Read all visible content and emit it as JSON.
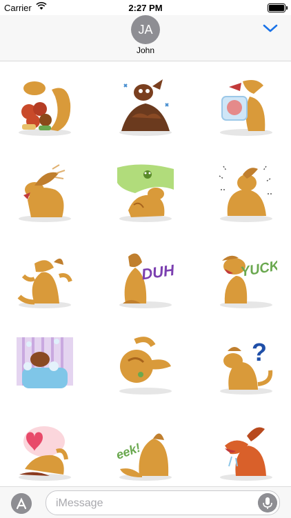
{
  "status_bar": {
    "carrier": "Carrier",
    "time": "2:27 PM"
  },
  "header": {
    "avatar_initials": "JA",
    "contact_name": "John"
  },
  "stickers": [
    {
      "name": "sticker-dog-burgers",
      "caption": ""
    },
    {
      "name": "sticker-dog-mud-pile",
      "caption": ""
    },
    {
      "name": "sticker-dog-ice-cube",
      "caption": ""
    },
    {
      "name": "sticker-dog-scratching",
      "caption": ""
    },
    {
      "name": "sticker-dog-stink",
      "caption": ""
    },
    {
      "name": "sticker-dog-shaking",
      "caption": ""
    },
    {
      "name": "sticker-dog-pointing",
      "caption": ""
    },
    {
      "name": "sticker-dog-duh",
      "caption": "DUH"
    },
    {
      "name": "sticker-dog-yuck",
      "caption": "YUCK"
    },
    {
      "name": "sticker-dog-bath",
      "caption": ""
    },
    {
      "name": "sticker-dog-rolling",
      "caption": ""
    },
    {
      "name": "sticker-dog-question",
      "caption": "?"
    },
    {
      "name": "sticker-dog-love",
      "caption": ""
    },
    {
      "name": "sticker-dog-eek",
      "caption": "eek!"
    },
    {
      "name": "sticker-dog-howl",
      "caption": ""
    }
  ],
  "message_bar": {
    "placeholder": "iMessage"
  },
  "colors": {
    "accent": "#1a73e8",
    "dog": "#d99a3a",
    "dog_dark": "#a8641c"
  }
}
